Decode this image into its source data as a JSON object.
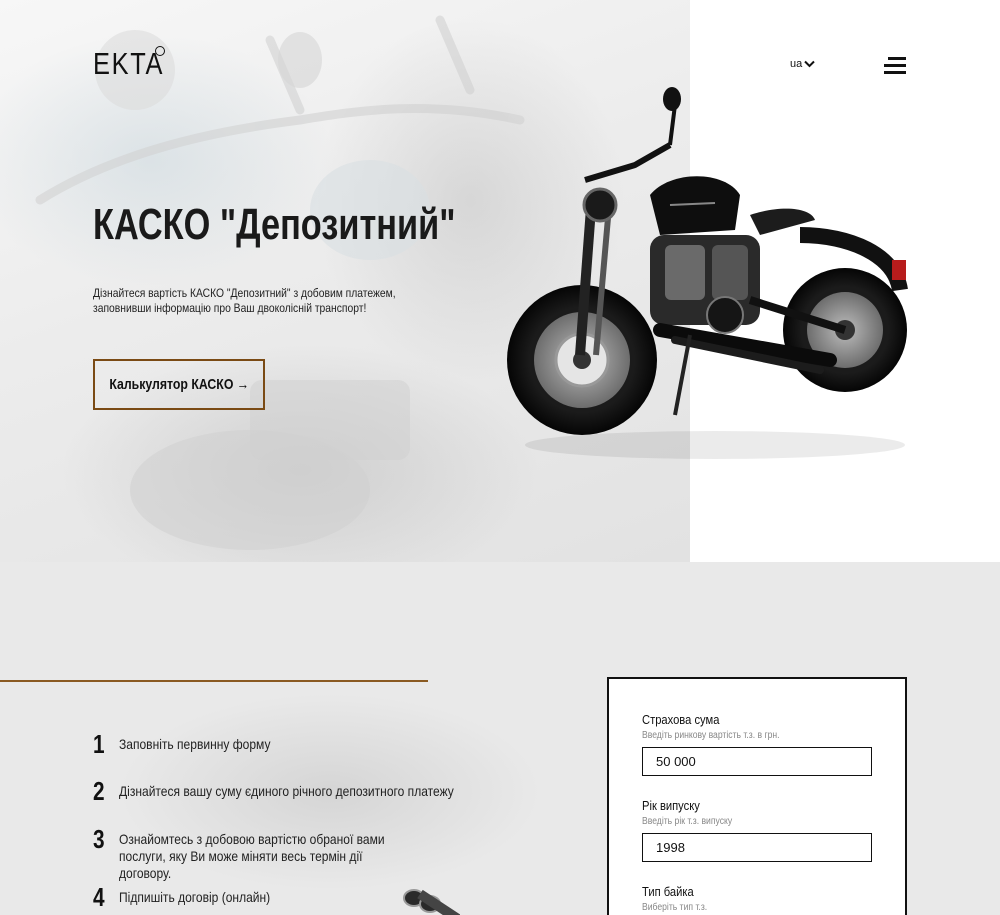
{
  "header": {
    "logo_text": "EKTA",
    "language": "ua",
    "menu_icon": "hamburger-menu-icon",
    "dropdown_icon": "chevron-down-icon"
  },
  "hero": {
    "title": "КАСКО \"Депозитний\"",
    "subtitle": "Дізнайтеся вартість КАСКО \"Депозитний\" з добовим платежем, заповнивши інформацію про Ваш двоколісній транспорт!",
    "cta_label": "Калькулятор КАСКО →",
    "colors": {
      "accent_border": "#7a4a14",
      "text": "#111111"
    }
  },
  "steps": [
    {
      "number": "1",
      "text": "Заповніть первинну форму"
    },
    {
      "number": "2",
      "text": "Дізнайтеся вашу суму єдиного річного депозитного платежу"
    },
    {
      "number": "3",
      "text": "Ознайомтесь з добовою вартістю обраної вами послуги, яку Ви може міняти весь термін дії договору."
    },
    {
      "number": "4",
      "text": "Підпишіть договір (онлайн)"
    }
  ],
  "form": {
    "insured_sum": {
      "label": "Страхова сума",
      "hint": "Введіть ринкову вартість т.з. в грн.",
      "value": "50 000"
    },
    "year": {
      "label": "Рік випуску",
      "hint": "Введіть рік т.з. випуску",
      "value": "1998"
    },
    "bike_type": {
      "label": "Тип байка",
      "hint": "Виберіть тип т.з."
    }
  },
  "colors": {
    "divider": "#8a5a22",
    "section_bg": "#e9e9e9"
  }
}
